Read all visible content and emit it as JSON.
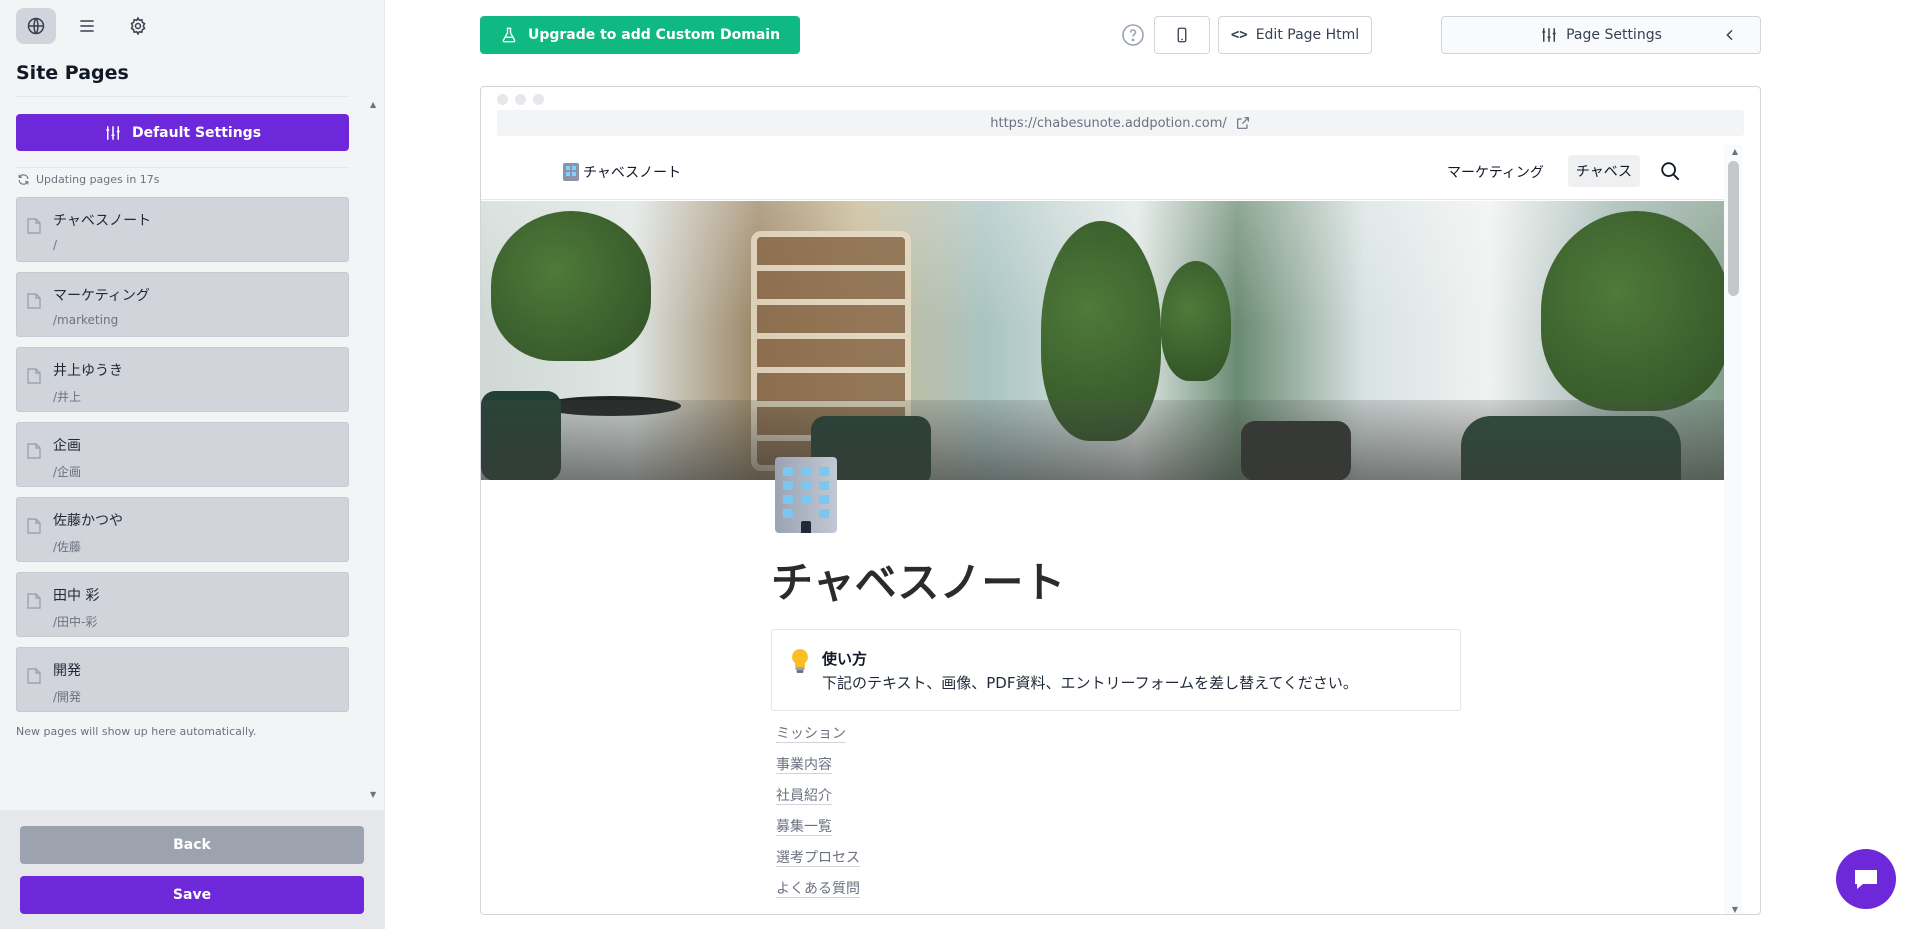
{
  "sidebar": {
    "title": "Site Pages",
    "default_settings_label": "Default Settings",
    "updating_text": "Updating pages in 17s",
    "hint": "New pages will show up here automatically.",
    "pages": [
      {
        "title": "チャベスノート",
        "slug": "/"
      },
      {
        "title": "マーケティング",
        "slug": "/marketing"
      },
      {
        "title": "井上ゆうき",
        "slug": "/井上"
      },
      {
        "title": "企画",
        "slug": "/企画"
      },
      {
        "title": "佐藤かつや",
        "slug": "/佐藤"
      },
      {
        "title": "田中 彩",
        "slug": "/田中-彩"
      },
      {
        "title": "開発",
        "slug": "/開発"
      }
    ],
    "back_label": "Back",
    "save_label": "Save"
  },
  "toolbar": {
    "upgrade_label": "Upgrade to add Custom Domain",
    "edit_html_label": "Edit Page Html",
    "edit_html_code": "<>",
    "page_settings_label": "Page Settings"
  },
  "browser": {
    "url": "https://chabesunote.addpotion.com/"
  },
  "site": {
    "logo_text": "チャベスノート",
    "nav_items": [
      "マーケティング",
      "チャベス"
    ],
    "page_title": "チャベスノート",
    "callout_title": "使い方",
    "callout_text": "下記のテキスト、画像、PDF資料、エントリーフォームを差し替えてください。",
    "toc": [
      "ミッション",
      "事業内容",
      "社員紹介",
      "募集一覧",
      "選考プロセス",
      "よくある質問"
    ]
  },
  "colors": {
    "primary": "#6d28d9",
    "upgrade": "#10b981",
    "back": "#9ca3af"
  }
}
